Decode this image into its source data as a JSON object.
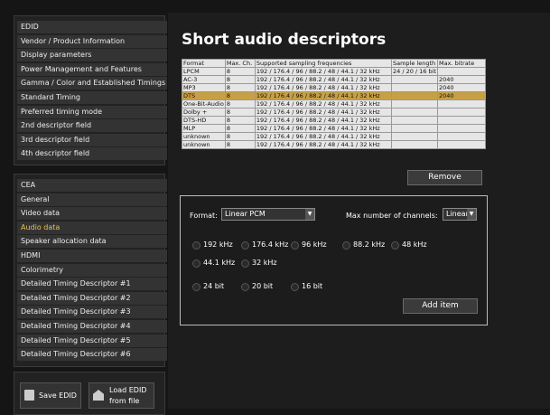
{
  "edid_menu": [
    "EDID",
    "Vendor / Product Information",
    "Display parameters",
    "Power Management and Features",
    "Gamma / Color and Established Timings",
    "Standard Timing",
    "Preferred timing mode",
    "2nd descriptor field",
    "3rd descriptor field",
    "4th descriptor field"
  ],
  "cea_menu": [
    "CEA",
    "General",
    "Video data",
    "Audio data",
    "Speaker allocation data",
    "HDMI",
    "Colorimetry",
    "Detailed Timing Descriptor #1",
    "Detailed Timing Descriptor #2",
    "Detailed Timing Descriptor #3",
    "Detailed Timing Descriptor #4",
    "Detailed Timing Descriptor #5",
    "Detailed Timing Descriptor #6"
  ],
  "active_menu_item": "Audio data",
  "title": "Short audio descriptors",
  "table": {
    "headers": [
      "Format",
      "Max. Ch.",
      "Supported sampling frequencies",
      "Sample length",
      "Max. bitrate"
    ],
    "rows": [
      [
        "LPCM",
        "8",
        "192 / 176.4 / 96 / 88.2 / 48 / 44.1 / 32 kHz",
        "24 / 20 / 16 bit",
        ""
      ],
      [
        "AC-3",
        "8",
        "192 / 176.4 / 96 / 88.2 / 48 / 44.1 / 32 kHz",
        "",
        "2040"
      ],
      [
        "MP3",
        "8",
        "192 / 176.4 / 96 / 88.2 / 48 / 44.1 / 32 kHz",
        "",
        "2040"
      ],
      [
        "DTS",
        "8",
        "192 / 176.4 / 96 / 88.2 / 48 / 44.1 / 32 kHz",
        "",
        "2040"
      ],
      [
        "One-Bit-Audio",
        "8",
        "192 / 176.4 / 96 / 88.2 / 48 / 44.1 / 32 kHz",
        "",
        ""
      ],
      [
        "Dolby +",
        "8",
        "192 / 176.4 / 96 / 88.2 / 48 / 44.1 / 32 kHz",
        "",
        ""
      ],
      [
        "DTS-HD",
        "8",
        "192 / 176.4 / 96 / 88.2 / 48 / 44.1 / 32 kHz",
        "",
        ""
      ],
      [
        "MLP",
        "8",
        "192 / 176.4 / 96 / 88.2 / 48 / 44.1 / 32 kHz",
        "",
        ""
      ],
      [
        "unknown",
        "8",
        "192 / 176.4 / 96 / 88.2 / 48 / 44.1 / 32 kHz",
        "",
        ""
      ],
      [
        "unknown",
        "8",
        "192 / 176.4 / 96 / 88.2 / 48 / 44.1 / 32 kHz",
        "",
        ""
      ]
    ],
    "selected_row": 3,
    "selected_color": "#c8a044"
  },
  "remove_label": "Remove",
  "format_label": "Format:",
  "format_value": "Linear PCM",
  "channels_label": "Max number of channels:",
  "channels_value": "Linear",
  "freq_row1": [
    "192 kHz",
    "176.4 kHz",
    "96 kHz",
    "88.2 kHz",
    "48 kHz"
  ],
  "freq_row2": [
    "44.1 kHz",
    "32 kHz"
  ],
  "bits": [
    "24 bit",
    "20 bit",
    "16 bit"
  ],
  "add_label": "Add item",
  "save_label": "Save EDID",
  "load_label_1": "Load EDID",
  "load_label_2": "from file",
  "accent_color": "#e8c44f"
}
